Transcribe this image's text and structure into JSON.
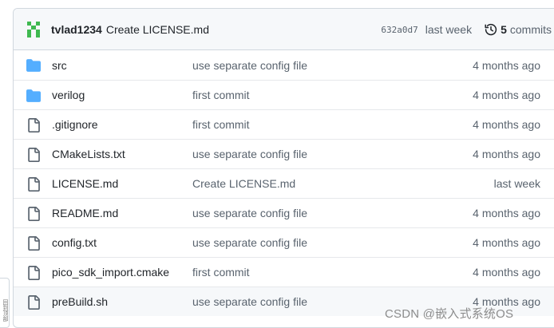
{
  "latest_commit": {
    "author": "tvlad1234",
    "message": "Create LICENSE.md",
    "sha": "632a0d7",
    "date": "last week",
    "commits_count": "5",
    "commits_label": "commits"
  },
  "files": [
    {
      "name": "src",
      "type": "folder",
      "commit": "use separate config file",
      "age": "4 months ago"
    },
    {
      "name": "verilog",
      "type": "folder",
      "commit": "first commit",
      "age": "4 months ago"
    },
    {
      "name": ".gitignore",
      "type": "file",
      "commit": "first commit",
      "age": "4 months ago"
    },
    {
      "name": "CMakeLists.txt",
      "type": "file",
      "commit": "use separate config file",
      "age": "4 months ago"
    },
    {
      "name": "LICENSE.md",
      "type": "file",
      "commit": "Create LICENSE.md",
      "age": "last week"
    },
    {
      "name": "README.md",
      "type": "file",
      "commit": "use separate config file",
      "age": "4 months ago"
    },
    {
      "name": "config.txt",
      "type": "file",
      "commit": "use separate config file",
      "age": "4 months ago"
    },
    {
      "name": "pico_sdk_import.cmake",
      "type": "file",
      "commit": "first commit",
      "age": "4 months ago"
    },
    {
      "name": "preBuild.sh",
      "type": "file",
      "commit": "use separate config file",
      "age": "4 months ago"
    }
  ],
  "watermark": "CSDN @嵌入式系统OS",
  "side_tab": "回到顶部",
  "colors": {
    "folder": "#54aeff",
    "file": "#59636e",
    "avatar": "#3fb950",
    "border": "#d0d7de",
    "header_bg": "#f6f8fa"
  }
}
